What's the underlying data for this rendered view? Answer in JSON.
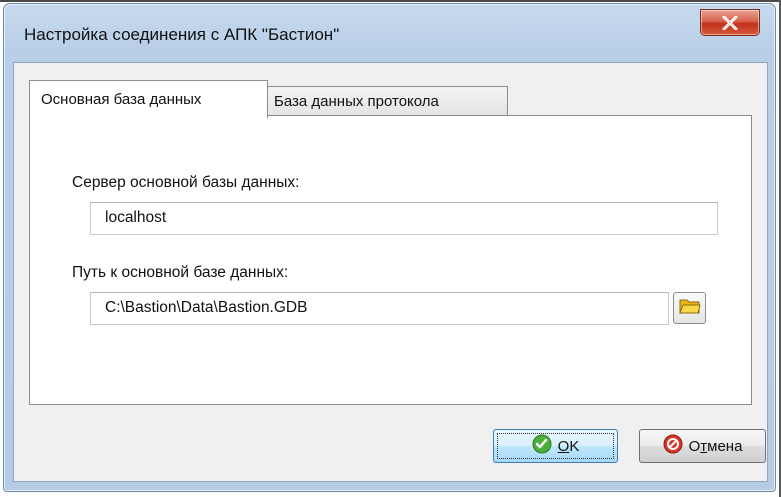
{
  "window": {
    "title": "Настройка соединения с АПК \"Бастион\"",
    "close_glyph": "X"
  },
  "tabs": [
    {
      "label": "Основная база данных",
      "active": true
    },
    {
      "label": "База данных протокола",
      "active": false
    }
  ],
  "main_db": {
    "server_label": "Сервер основной базы данных:",
    "server_value": "localhost",
    "path_label": "Путь к основной базе данных:",
    "path_value": "C:\\Bastion\\Data\\Bastion.GDB"
  },
  "buttons": {
    "ok": {
      "label_mnemonic": "O",
      "label_rest": "K"
    },
    "cancel": {
      "label_prefix": "О",
      "label_mnemonic": "т",
      "label_rest": "мена"
    }
  },
  "colors": {
    "ok_icon": "#4caf3a",
    "cancel_icon": "#d8352a",
    "folder_icon": "#f2c92f"
  }
}
